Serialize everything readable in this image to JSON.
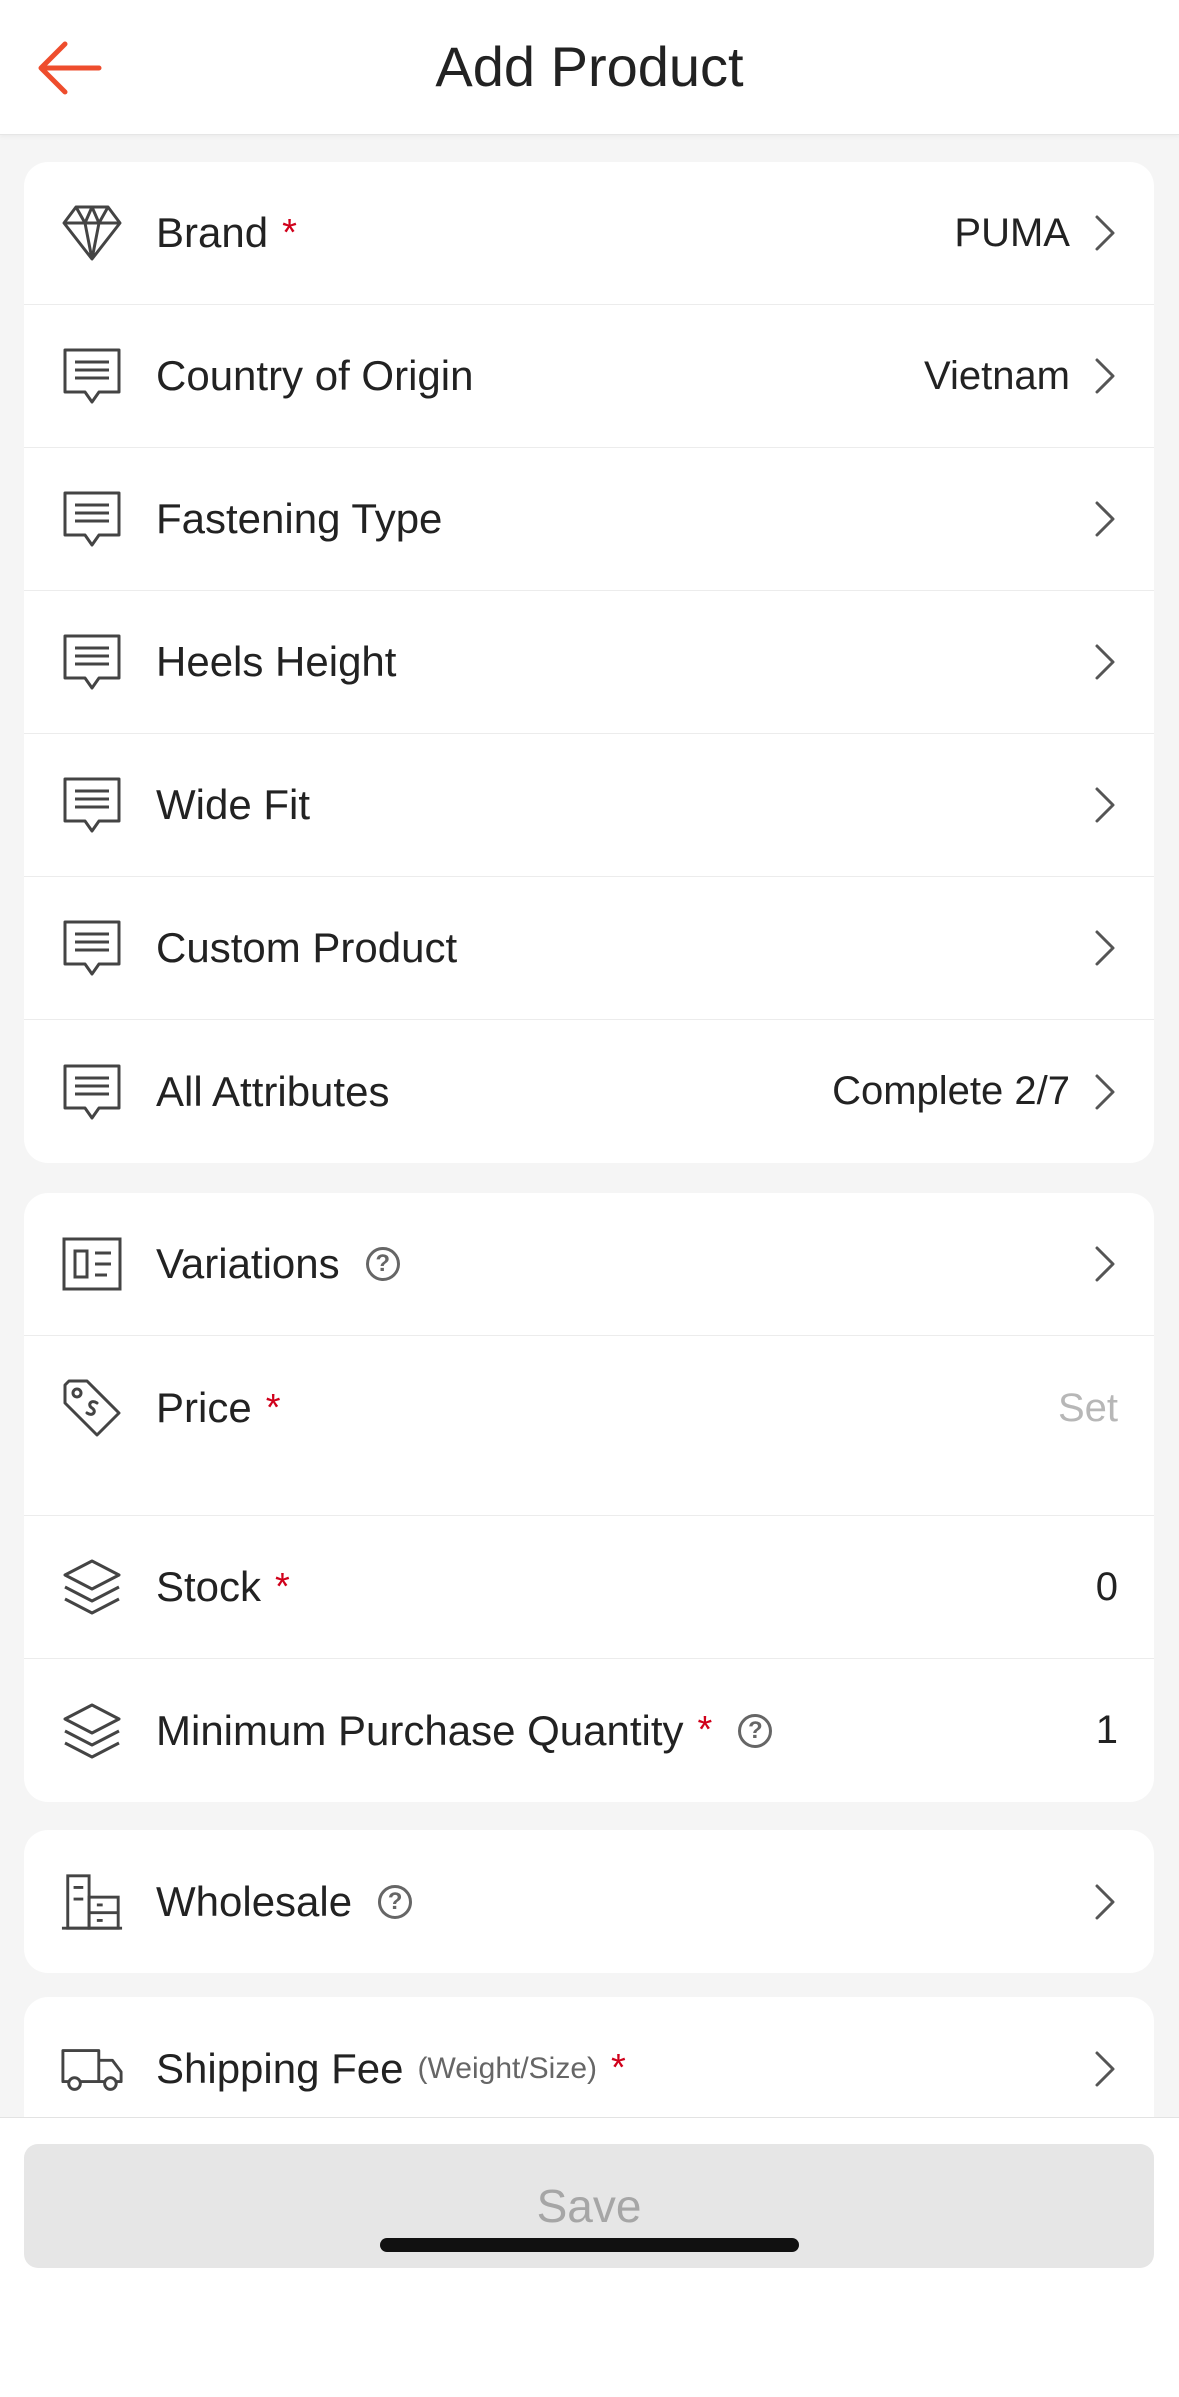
{
  "header": {
    "title": "Add Product",
    "back_icon": "arrow-left-icon",
    "accent": "#ee4d2d"
  },
  "attributes": [
    {
      "label": "Brand",
      "required": true,
      "value": "PUMA",
      "icon": "diamond-icon"
    },
    {
      "label": "Country of Origin",
      "required": false,
      "value": "Vietnam",
      "icon": "list-doc-icon"
    },
    {
      "label": "Fastening Type",
      "required": false,
      "value": "",
      "icon": "list-doc-icon"
    },
    {
      "label": "Heels Height",
      "required": false,
      "value": "",
      "icon": "list-doc-icon"
    },
    {
      "label": "Wide Fit",
      "required": false,
      "value": "",
      "icon": "list-doc-icon"
    },
    {
      "label": "Custom Product",
      "required": false,
      "value": "",
      "icon": "list-doc-icon"
    },
    {
      "label": "All Attributes",
      "required": false,
      "value": "Complete 2/7",
      "icon": "list-doc-icon"
    }
  ],
  "sales": {
    "variations": {
      "label": "Variations",
      "help": "?"
    },
    "price": {
      "label": "Price",
      "required_mark": "*",
      "placeholder": "Set"
    },
    "stock": {
      "label": "Stock",
      "required_mark": "*",
      "value": "0"
    },
    "min_qty": {
      "label": "Minimum Purchase Quantity",
      "required_mark": "*",
      "help": "?",
      "value": "1"
    }
  },
  "wholesale": {
    "label": "Wholesale",
    "help": "?"
  },
  "shipping": {
    "label": "Shipping Fee",
    "note": "(Weight/Size)",
    "required_mark": "*"
  },
  "footer": {
    "save_label": "Save"
  },
  "colors": {
    "required": "#d0011b",
    "muted": "#b7b7b7",
    "disabled_button": "#e6e6e6"
  }
}
